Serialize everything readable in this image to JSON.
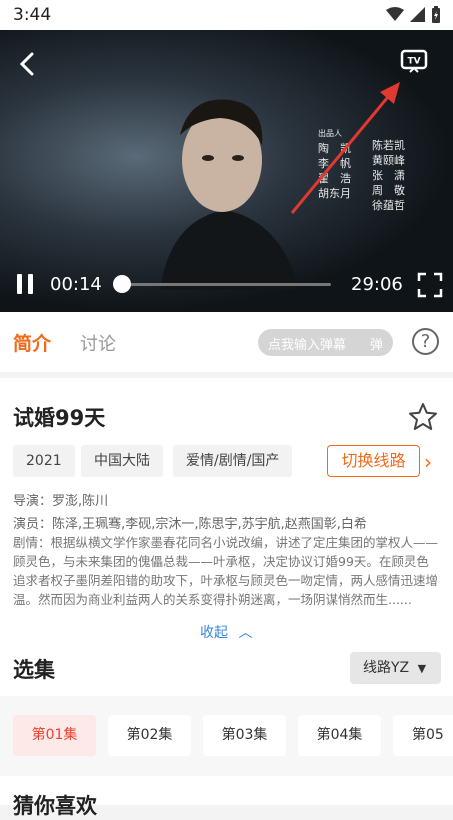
{
  "status": {
    "time": "3:44"
  },
  "player": {
    "current_time": "00:14",
    "duration": "29:06",
    "progress": 0.008,
    "credits": [
      "出品人",
      "陶　凯",
      "李　帆",
      "翟　浩",
      "胡东月",
      "陈若凯",
      "黄颐峰",
      "张　潇",
      "周　敬",
      "徐蕴哲"
    ]
  },
  "tabs": {
    "intro": "简介",
    "discuss": "讨论"
  },
  "danmu": {
    "placeholder": "点我输入弹幕",
    "send": "弹"
  },
  "help": {
    "label": "?"
  },
  "show": {
    "title": "试婚99天",
    "tags": [
      "2021",
      "中国大陆",
      "爱情/剧情/国产"
    ],
    "switch_label": "切换线路",
    "director": "导演：罗澎,陈川",
    "cast": "演员：陈泽,王珮骞,李砚,宗沐一,陈思宇,苏宇航,赵燕国彰,白希",
    "plot": "剧情：根据纵横文学作家墨春花同名小说改编，讲述了定庄集团的掌权人——顾灵色，与未来集团的傀儡总裁——叶承枢，决定协议订婚99天。在顾灵色追求者权子墨阴差阳错的助攻下，叶承枢与顾灵色一吻定情，两人感情迅速增温。然而因为商业利益两人的关系变得扑朔迷离，一场阴谋悄然而生......",
    "collapse": "收起"
  },
  "episodes": {
    "heading": "选集",
    "route": "线路YZ",
    "items": [
      "第01集",
      "第02集",
      "第03集",
      "第04集",
      "第05"
    ]
  },
  "guess": {
    "heading": "猜你喜欢"
  },
  "colors": {
    "accent": "#f26a1b",
    "link": "#3a86e0",
    "arrow": "#e0392f"
  }
}
